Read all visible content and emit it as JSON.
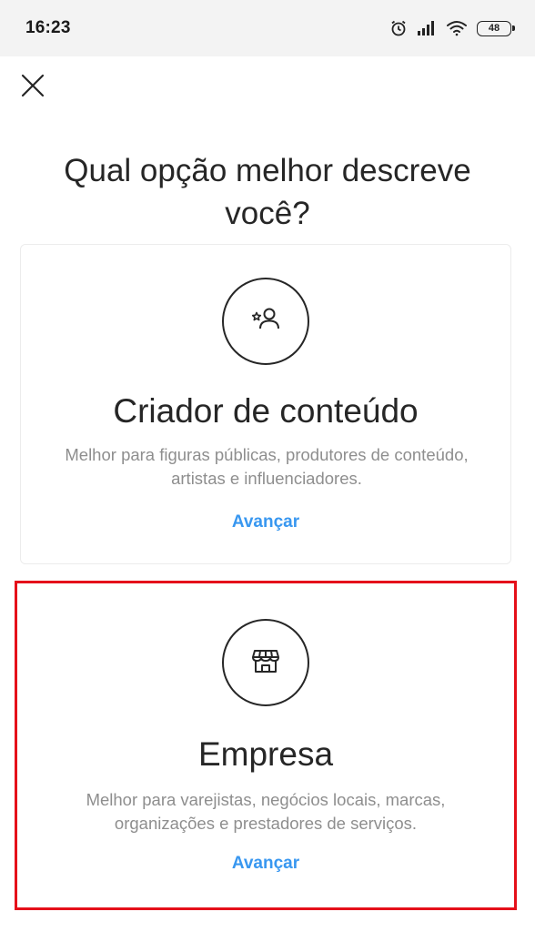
{
  "status_bar": {
    "time": "16:23",
    "battery": "48",
    "icons": [
      "alarm-icon",
      "signal-icon",
      "wifi-icon",
      "battery-icon"
    ]
  },
  "header": {
    "close_icon": "close-icon"
  },
  "question": "Qual opção melhor descreve você?",
  "options": [
    {
      "icon": "star-person-icon",
      "title": "Criador de conteúdo",
      "description": "Melhor para figuras públicas, produtores de conteúdo, artistas e influenciadores.",
      "action": "Avançar"
    },
    {
      "icon": "storefront-icon",
      "title": "Empresa",
      "description": "Melhor para varejistas, negócios locais, marcas, organizações e prestadores de serviços.",
      "action": "Avançar"
    }
  ],
  "colors": {
    "link": "#3897f0",
    "highlight_border": "#e5101a",
    "secondary_text": "#8e8e8e"
  }
}
